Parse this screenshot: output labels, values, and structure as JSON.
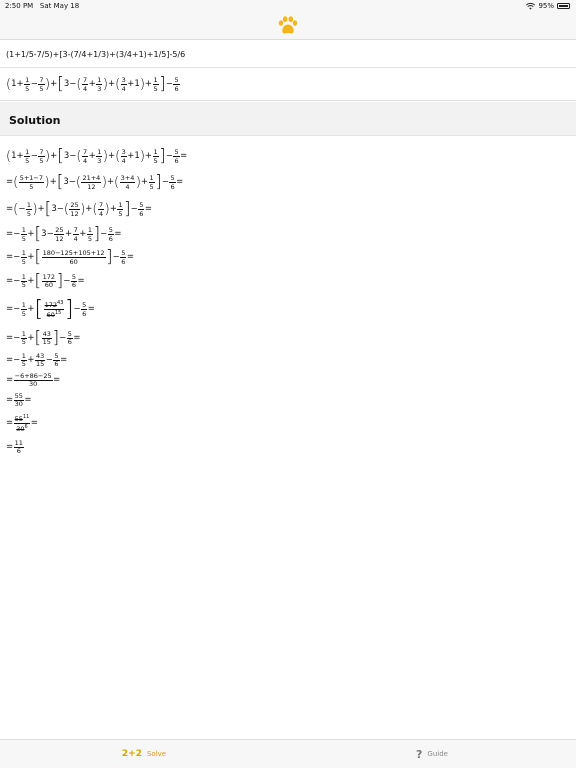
{
  "status_bar": {
    "time": "2:50 PM",
    "date": "Sat May 18",
    "battery": "95%"
  },
  "navbar": {
    "logo_icon": "paw-print-icon",
    "accent": "#F2B51C"
  },
  "input": {
    "expression": "(1+1/5-7/5)+[3-(7/4+1/3)+(3/4+1)+1/5]-5/6"
  },
  "solution": {
    "heading": "Solution"
  },
  "tabs": [
    {
      "icon_text": "2+2",
      "label": "Solve",
      "active": true
    },
    {
      "icon_text": "?",
      "label": "Guide",
      "active": false
    }
  ],
  "colors": {
    "active_tab": "#D9A10D",
    "inactive_tab": "#888888",
    "bar_background": "#F7F7F7"
  }
}
